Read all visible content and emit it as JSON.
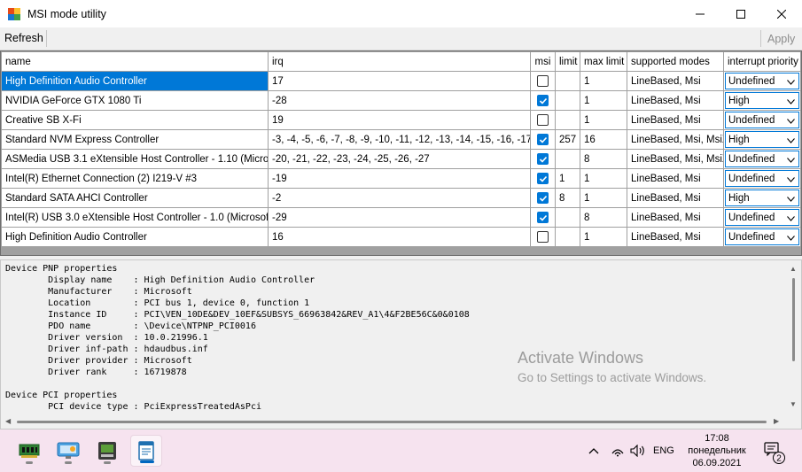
{
  "window": {
    "title": "MSI mode utility",
    "minimize_icon": "minimize-icon",
    "maximize_icon": "maximize-icon",
    "close_icon": "close-icon"
  },
  "toolbar": {
    "refresh_label": "Refresh",
    "apply_label": "Apply"
  },
  "grid": {
    "columns": [
      "name",
      "irq",
      "msi",
      "limit",
      "max limit",
      "supported modes",
      "interrupt priority"
    ],
    "rows": [
      {
        "name": "High Definition Audio Controller",
        "irq": "17",
        "msi": false,
        "limit": "",
        "max_limit": "1",
        "modes": "LineBased, Msi",
        "priority": "Undefined",
        "selected": true
      },
      {
        "name": "NVIDIA GeForce GTX 1080 Ti",
        "irq": "-28",
        "msi": true,
        "limit": "",
        "max_limit": "1",
        "modes": "LineBased, Msi",
        "priority": "High"
      },
      {
        "name": "Creative SB X-Fi",
        "irq": "19",
        "msi": false,
        "limit": "",
        "max_limit": "1",
        "modes": "LineBased, Msi",
        "priority": "Undefined"
      },
      {
        "name": "Standard NVM Express Controller",
        "irq": "-3, -4, -5, -6, -7, -8, -9, -10, -11, -12, -13, -14, -15, -16, -17, -18",
        "msi": true,
        "limit": "257",
        "max_limit": "16",
        "modes": "LineBased, Msi, MsiX",
        "priority": "High"
      },
      {
        "name": "ASMedia USB 3.1 eXtensible Host Controller - 1.10 (Microsoft)",
        "irq": "-20, -21, -22, -23, -24, -25, -26, -27",
        "msi": true,
        "limit": "",
        "max_limit": "8",
        "modes": "LineBased, Msi, MsiX",
        "priority": "Undefined"
      },
      {
        "name": "Intel(R) Ethernet Connection (2) I219-V #3",
        "irq": "-19",
        "msi": true,
        "limit": "1",
        "max_limit": "1",
        "modes": "LineBased, Msi",
        "priority": "Undefined"
      },
      {
        "name": "Standard SATA AHCI Controller",
        "irq": "-2",
        "msi": true,
        "limit": "8",
        "max_limit": "1",
        "modes": "LineBased, Msi",
        "priority": "High"
      },
      {
        "name": "Intel(R) USB 3.0 eXtensible Host Controller - 1.0 (Microsoft)",
        "irq": "-29",
        "msi": true,
        "limit": "",
        "max_limit": "8",
        "modes": "LineBased, Msi",
        "priority": "Undefined"
      },
      {
        "name": "High Definition Audio Controller",
        "irq": "16",
        "msi": false,
        "limit": "",
        "max_limit": "1",
        "modes": "LineBased, Msi",
        "priority": "Undefined"
      }
    ]
  },
  "details": {
    "text": "Device PNP properties\n        Display name    : High Definition Audio Controller\n        Manufacturer    : Microsoft\n        Location        : PCI bus 1, device 0, function 1\n        Instance ID     : PCI\\VEN_10DE&DEV_10EF&SUBSYS_66963842&REV_A1\\4&F2BE56C&0&0108\n        PDO name        : \\Device\\NTPNP_PCI0016\n        Driver version  : 10.0.21996.1\n        Driver inf-path : hdaudbus.inf\n        Driver provider : Microsoft\n        Driver rank     : 16719878\n\nDevice PCI properties\n        PCI device type : PciExpressTreatedAsPci"
  },
  "watermark": {
    "line1": "Activate Windows",
    "line2": "Go to Settings to activate Windows."
  },
  "taskbar": {
    "apps": [
      "memory-app-icon",
      "remote-desktop-icon",
      "gpu-utility-icon",
      "notepad-icon"
    ],
    "tray": {
      "language": "ENG"
    },
    "clock": {
      "time": "17:08",
      "day": "понедельник",
      "date": "06.09.2021"
    },
    "notification_count": "2"
  },
  "colors": {
    "accent": "#0078d7",
    "taskbar": "#f6e3ef"
  }
}
